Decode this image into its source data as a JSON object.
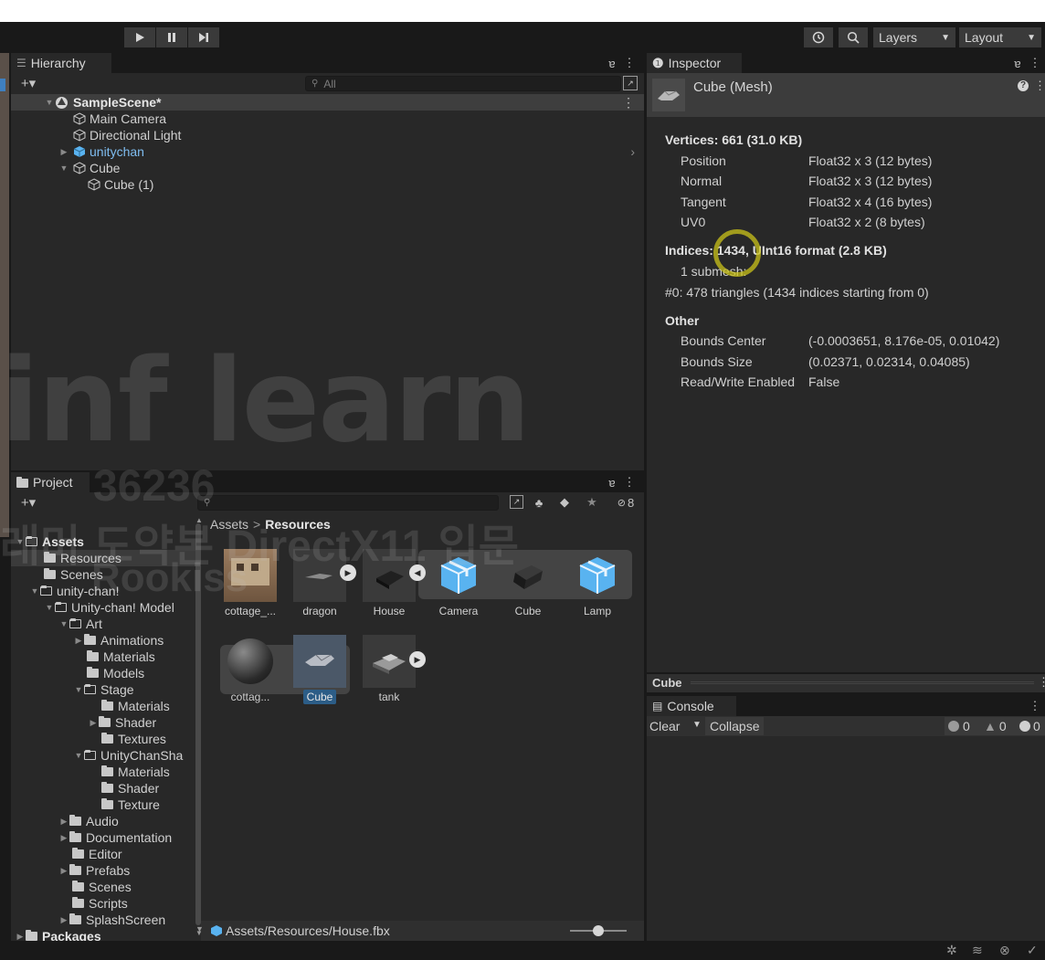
{
  "toolbar": {
    "play_icon": "play-icon",
    "pause_icon": "pause-icon",
    "step_icon": "step-icon",
    "history_icon": "history-icon",
    "search_icon": "search-icon",
    "layers_label": "Layers",
    "layout_label": "Layout"
  },
  "hierarchy": {
    "tab_label": "Hierarchy",
    "search_placeholder": "All",
    "add_label": "+▾",
    "scene": "SampleScene*",
    "items": [
      {
        "label": "Main Camera"
      },
      {
        "label": "Directional Light"
      },
      {
        "label": "unitychan"
      },
      {
        "label": "Cube"
      },
      {
        "label": "Cube (1)"
      }
    ]
  },
  "inspector": {
    "tab_label": "Inspector",
    "object_title": "Cube (Mesh)",
    "vertices_heading": "Vertices: 661 (31.0 KB)",
    "vertex_attrs": [
      {
        "name": "Position",
        "value": "Float32 x 3 (12 bytes)"
      },
      {
        "name": "Normal",
        "value": "Float32 x 3 (12 bytes)"
      },
      {
        "name": "Tangent",
        "value": "Float32 x 4 (16 bytes)"
      },
      {
        "name": "UV0",
        "value": "Float32 x 2 (8 bytes)"
      }
    ],
    "indices_heading": "Indices: 1434, UInt16 format (2.8 KB)",
    "submesh_count": "1 submesh:",
    "submesh_detail": "#0: 478 triangles (1434 indices starting from 0)",
    "other_heading": "Other",
    "other_props": [
      {
        "name": "Bounds Center",
        "value": "(-0.0003651, 8.176e-05, 0.01042)"
      },
      {
        "name": "Bounds Size",
        "value": "(0.02371, 0.02314, 0.04085)"
      },
      {
        "name": "Read/Write Enabled",
        "value": "False"
      }
    ],
    "preview_label": "Cube"
  },
  "project": {
    "tab_label": "Project",
    "add_label": "+▾",
    "hidden_count": "8",
    "breadcrumb_root": "Assets",
    "breadcrumb_sep": ">",
    "breadcrumb_current": "Resources",
    "tree": [
      {
        "label": "Assets"
      },
      {
        "label": "Resources"
      },
      {
        "label": "Scenes"
      },
      {
        "label": "unity-chan!"
      },
      {
        "label": "Unity-chan! Model"
      },
      {
        "label": "Art"
      },
      {
        "label": "Animations"
      },
      {
        "label": "Materials"
      },
      {
        "label": "Models"
      },
      {
        "label": "Stage"
      },
      {
        "label": "Materials"
      },
      {
        "label": "Shader"
      },
      {
        "label": "Textures"
      },
      {
        "label": "UnityChanSha"
      },
      {
        "label": "Materials"
      },
      {
        "label": "Shader"
      },
      {
        "label": "Texture"
      },
      {
        "label": "Audio"
      },
      {
        "label": "Documentation"
      },
      {
        "label": "Editor"
      },
      {
        "label": "Prefabs"
      },
      {
        "label": "Scenes"
      },
      {
        "label": "Scripts"
      },
      {
        "label": "SplashScreen"
      },
      {
        "label": "Packages"
      }
    ],
    "assets": [
      {
        "label": "cottage_..."
      },
      {
        "label": "dragon"
      },
      {
        "label": "House"
      },
      {
        "label": "Camera"
      },
      {
        "label": "Cube"
      },
      {
        "label": "Lamp"
      },
      {
        "label": "cottag..."
      },
      {
        "label": "Cube"
      },
      {
        "label": "tank"
      }
    ],
    "selected_path": "Assets/Resources/House.fbx"
  },
  "console": {
    "tab_label": "Console",
    "clear_label": "Clear",
    "collapse_label": "Collapse",
    "info_count": "0",
    "warn_count": "0",
    "error_count": "0"
  },
  "watermark": {
    "brand": "inf learn",
    "id": "36236",
    "course": "래머 도약본 DirectX11 입문",
    "user": "Rookiss"
  },
  "colors": {
    "panel_bg": "#282828",
    "dark_bg": "#191919",
    "selection": "#2c5d87",
    "prefab_blue": "#59b3f0",
    "highlight_ring": "#c9c21a"
  }
}
